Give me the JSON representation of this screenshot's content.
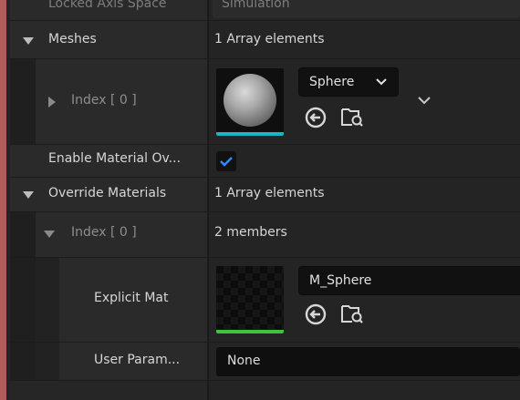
{
  "rows": {
    "locked_axis": {
      "label": "Locked Axis Space",
      "value": "Simulation"
    },
    "meshes": {
      "label": "Meshes",
      "value": "1 Array elements"
    },
    "mesh_index": {
      "label": "Index [ 0 ]",
      "combo_value": "Sphere"
    },
    "enable_override": {
      "label": "Enable Material Ov...",
      "checked": true
    },
    "override_materials": {
      "label": "Override Materials",
      "value": "1 Array elements"
    },
    "material_index": {
      "label": "Index [ 0 ]",
      "value": "2 members"
    },
    "explicit_mat": {
      "label": "Explicit Mat",
      "combo_value": "M_Sphere"
    },
    "user_param": {
      "label": "User Param...",
      "value": "None"
    }
  },
  "icons": {
    "use_selected": "arrow-left-circle-icon",
    "browse": "folder-search-icon",
    "expand": "chevron-down-icon"
  },
  "colors": {
    "accent_left": "#b35a5d",
    "mesh_thumb_bar": "#19b4c8",
    "material_thumb_bar": "#3ec43b",
    "checkbox_mark": "#2f8cff"
  }
}
